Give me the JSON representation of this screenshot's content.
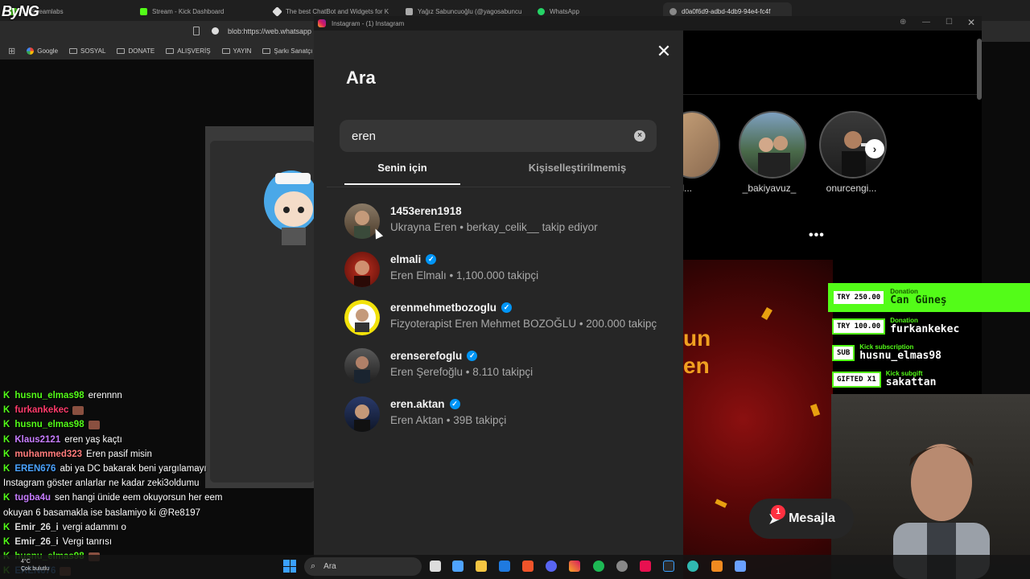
{
  "browser": {
    "tabs": [
      {
        "label": "d / Streamlabs",
        "color": "#53fc18"
      },
      {
        "label": "Stream - Kick Dashboard",
        "color": "#53fc18"
      },
      {
        "label": "The best ChatBot and Widgets for K",
        "color": "#dddddd"
      },
      {
        "label": "Yağız Sabuncuoğlu (@yagosabuncu",
        "color": "#aaaaaa"
      },
      {
        "label": "WhatsApp",
        "color": "#25d366"
      },
      {
        "label": "d0a0f6d9-adbd-4db9-94e4-fc4f",
        "color": "#888888"
      }
    ],
    "address": "blob:https://web.whatsapp",
    "bookmarks": [
      "Google",
      "SOSYAL",
      "DONATE",
      "ALIŞVERİŞ",
      "YAYIN",
      "Şarkı Sanatçı"
    ],
    "logo": "ByNG"
  },
  "instagram": {
    "window_title": "Instagram - (1) Instagram",
    "modal": {
      "title": "Ara",
      "search_value": "eren",
      "tab_for_you": "Senin için",
      "tab_unpersonalized": "Kişiselleştirilmemiş",
      "results": [
        {
          "username": "1453eren1918",
          "verified": false,
          "subtitle": "Ukrayna Eren • berkay_celik__ takip ediyor"
        },
        {
          "username": "elmali",
          "verified": true,
          "subtitle": "Eren Elmalı • 1,100.000 takipçi"
        },
        {
          "username": "erenmehmetbozoglu",
          "verified": true,
          "subtitle": "Fizyoterapist Eren Mehmet BOZOĞLU • 200.000 takipç"
        },
        {
          "username": "erenserefoglu",
          "verified": true,
          "subtitle": "Eren Şerefoğlu • 8.110 takipçi"
        },
        {
          "username": "eren.aktan",
          "verified": true,
          "subtitle": "Eren Aktan • 39B takipçi"
        }
      ]
    },
    "stories": [
      "nnyl...",
      "_bakiyavuz_",
      "onurcengi..."
    ],
    "post_text": [
      "un",
      "en"
    ],
    "messages_label": "Mesajla",
    "messages_badge": "1"
  },
  "donations": [
    {
      "badge": "TRY 250.00",
      "type": "Donation",
      "name": "Can Güneş"
    },
    {
      "badge": "TRY 100.00",
      "type": "Donation",
      "name": "furkankekec"
    },
    {
      "badge": "SUB",
      "type": "Kick subscription",
      "name": "husnu_elmas98"
    },
    {
      "badge": "GIFTED X1",
      "type": "Kick subgift",
      "name": "sakattan"
    }
  ],
  "chat": [
    {
      "user": "husnu_elmas98",
      "color": "#53fc18",
      "msg": "erennnn",
      "emote": false
    },
    {
      "user": "furkankekec",
      "color": "#ff3b6b",
      "msg": "",
      "emote": true
    },
    {
      "user": "husnu_elmas98",
      "color": "#53fc18",
      "msg": "",
      "emote": true
    },
    {
      "user": "Klaus2121",
      "color": "#c77dff",
      "msg": "eren yaş kaçtı",
      "emote": false
    },
    {
      "user": "muhammed323",
      "color": "#ff7b7b",
      "msg": "Eren pasif misin",
      "emote": false
    },
    {
      "user": "EREN676",
      "color": "#4aa3ff",
      "msg": "abi ya DC bakarak beni yargılamayı",
      "emote": false
    },
    {
      "user": "",
      "color": "#ffffff",
      "msg": "Instagram göster anlarlar ne kadar zeki3oldumu",
      "emote": false
    },
    {
      "user": "tugba4u",
      "color": "#c77dff",
      "msg": "sen hangi ünide eem okuyorsun her eem",
      "emote": false
    },
    {
      "user": "",
      "color": "#ffffff",
      "msg": "okuyan 6 basamakla ise baslamiyo ki @Re8197",
      "emote": false
    },
    {
      "user": "Emir_26_i",
      "color": "#dddddd",
      "msg": "vergi adammı o",
      "emote": false
    },
    {
      "user": "Emir_26_i",
      "color": "#dddddd",
      "msg": "Vergi tanrısı",
      "emote": false
    },
    {
      "user": "husnu_elmas98",
      "color": "#53fc18",
      "msg": "",
      "emote": true
    },
    {
      "user": "EREN676",
      "color": "#4aa3ff",
      "msg": "",
      "emote": true
    }
  ],
  "taskbar": {
    "search": "Ara",
    "weather_temp": "4°C",
    "weather_desc": "Çok bulutlu"
  }
}
